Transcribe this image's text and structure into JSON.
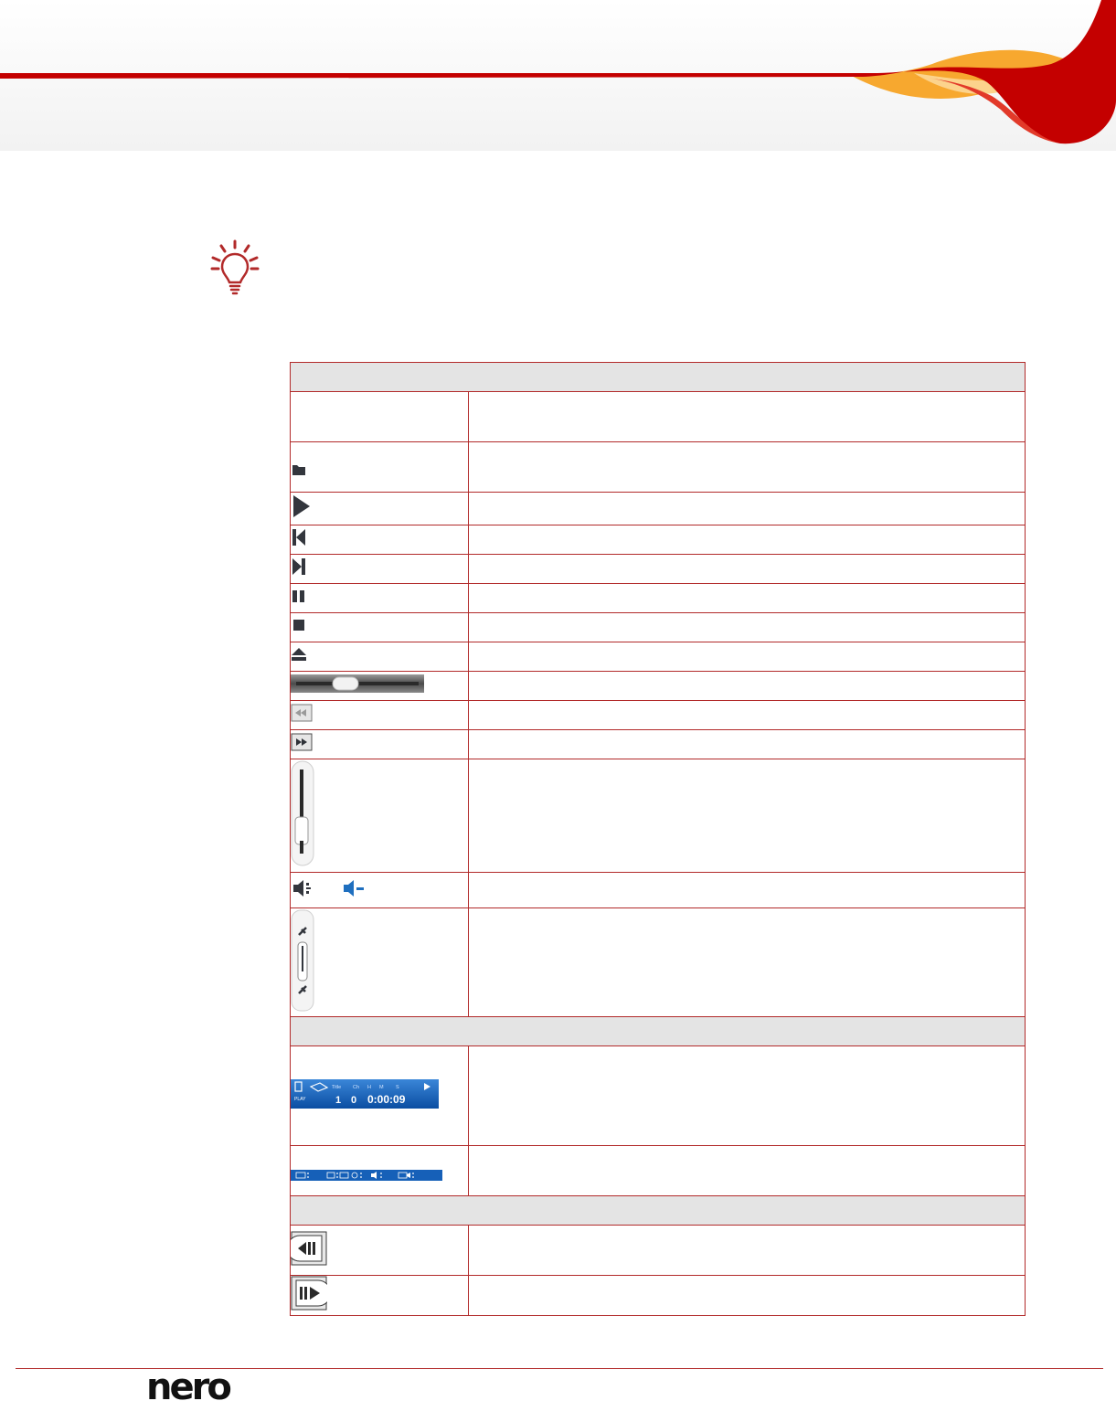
{
  "page": {
    "brand_color": "#c40000",
    "accent_color": "#f7a82f",
    "border_color": "#b22a2a",
    "section_bg": "#e4e4e4"
  },
  "logo": {
    "text": "nero"
  },
  "tip": {
    "icon": "lightbulb-icon"
  },
  "table": {
    "sections": [
      {
        "rows": [
          {
            "icon": ""
          },
          {
            "icon": "folder-icon"
          },
          {
            "icon": "play-icon"
          },
          {
            "icon": "previous-icon"
          },
          {
            "icon": "next-icon"
          },
          {
            "icon": "pause-icon"
          },
          {
            "icon": "stop-icon"
          },
          {
            "icon": "eject-icon"
          },
          {
            "icon": "position-slider-icon"
          },
          {
            "icon": "rewind-icon"
          },
          {
            "icon": "fast-forward-icon"
          },
          {
            "icon": "volume-slider-icon"
          },
          {
            "icon": "mute-icon"
          },
          {
            "icon": "zoom-slider-icon"
          }
        ]
      },
      {
        "rows": [
          {
            "icon": "playback-status-display",
            "display": {
              "labels": [
                "Title",
                "Ch",
                "H",
                "M",
                "S"
              ],
              "title": "1",
              "chapter": "0",
              "time": "0:00:09"
            }
          },
          {
            "icon": "info-bar-display"
          }
        ]
      },
      {
        "rows": [
          {
            "icon": "step-backward-icon"
          },
          {
            "icon": "step-forward-icon"
          }
        ]
      }
    ]
  }
}
